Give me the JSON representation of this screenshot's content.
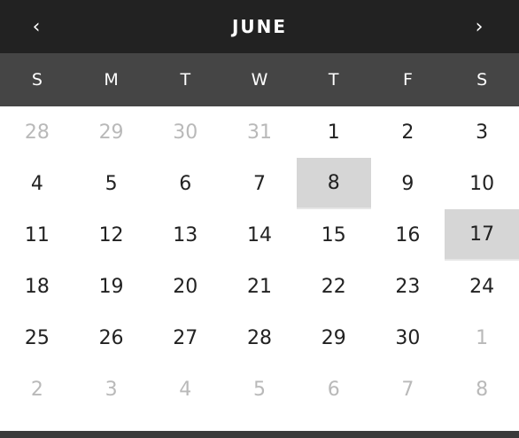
{
  "header": {
    "month": "JUNE",
    "prev_label": "‹",
    "next_label": "›"
  },
  "weekdays": [
    "S",
    "M",
    "T",
    "W",
    "T",
    "F",
    "S"
  ],
  "weeks": [
    [
      {
        "label": "28",
        "muted": true
      },
      {
        "label": "29",
        "muted": true
      },
      {
        "label": "30",
        "muted": true
      },
      {
        "label": "31",
        "muted": true
      },
      {
        "label": "1"
      },
      {
        "label": "2"
      },
      {
        "label": "3"
      }
    ],
    [
      {
        "label": "4"
      },
      {
        "label": "5"
      },
      {
        "label": "6"
      },
      {
        "label": "7"
      },
      {
        "label": "8",
        "selected": true
      },
      {
        "label": "9"
      },
      {
        "label": "10"
      }
    ],
    [
      {
        "label": "11"
      },
      {
        "label": "12"
      },
      {
        "label": "13"
      },
      {
        "label": "14"
      },
      {
        "label": "15"
      },
      {
        "label": "16"
      },
      {
        "label": "17",
        "selected": true
      }
    ],
    [
      {
        "label": "18"
      },
      {
        "label": "19"
      },
      {
        "label": "20"
      },
      {
        "label": "21"
      },
      {
        "label": "22"
      },
      {
        "label": "23"
      },
      {
        "label": "24"
      }
    ],
    [
      {
        "label": "25"
      },
      {
        "label": "26"
      },
      {
        "label": "27"
      },
      {
        "label": "28"
      },
      {
        "label": "29"
      },
      {
        "label": "30"
      },
      {
        "label": "1",
        "muted": true
      }
    ],
    [
      {
        "label": "2",
        "muted": true
      },
      {
        "label": "3",
        "muted": true
      },
      {
        "label": "4",
        "muted": true
      },
      {
        "label": "5",
        "muted": true
      },
      {
        "label": "6",
        "muted": true
      },
      {
        "label": "7",
        "muted": true
      },
      {
        "label": "8",
        "muted": true
      }
    ]
  ],
  "colors": {
    "header_bg": "#222222",
    "weekday_bg": "#454545",
    "selected_bg": "#d6d6d6",
    "muted_text": "#b9b9b9",
    "text": "#222222"
  }
}
